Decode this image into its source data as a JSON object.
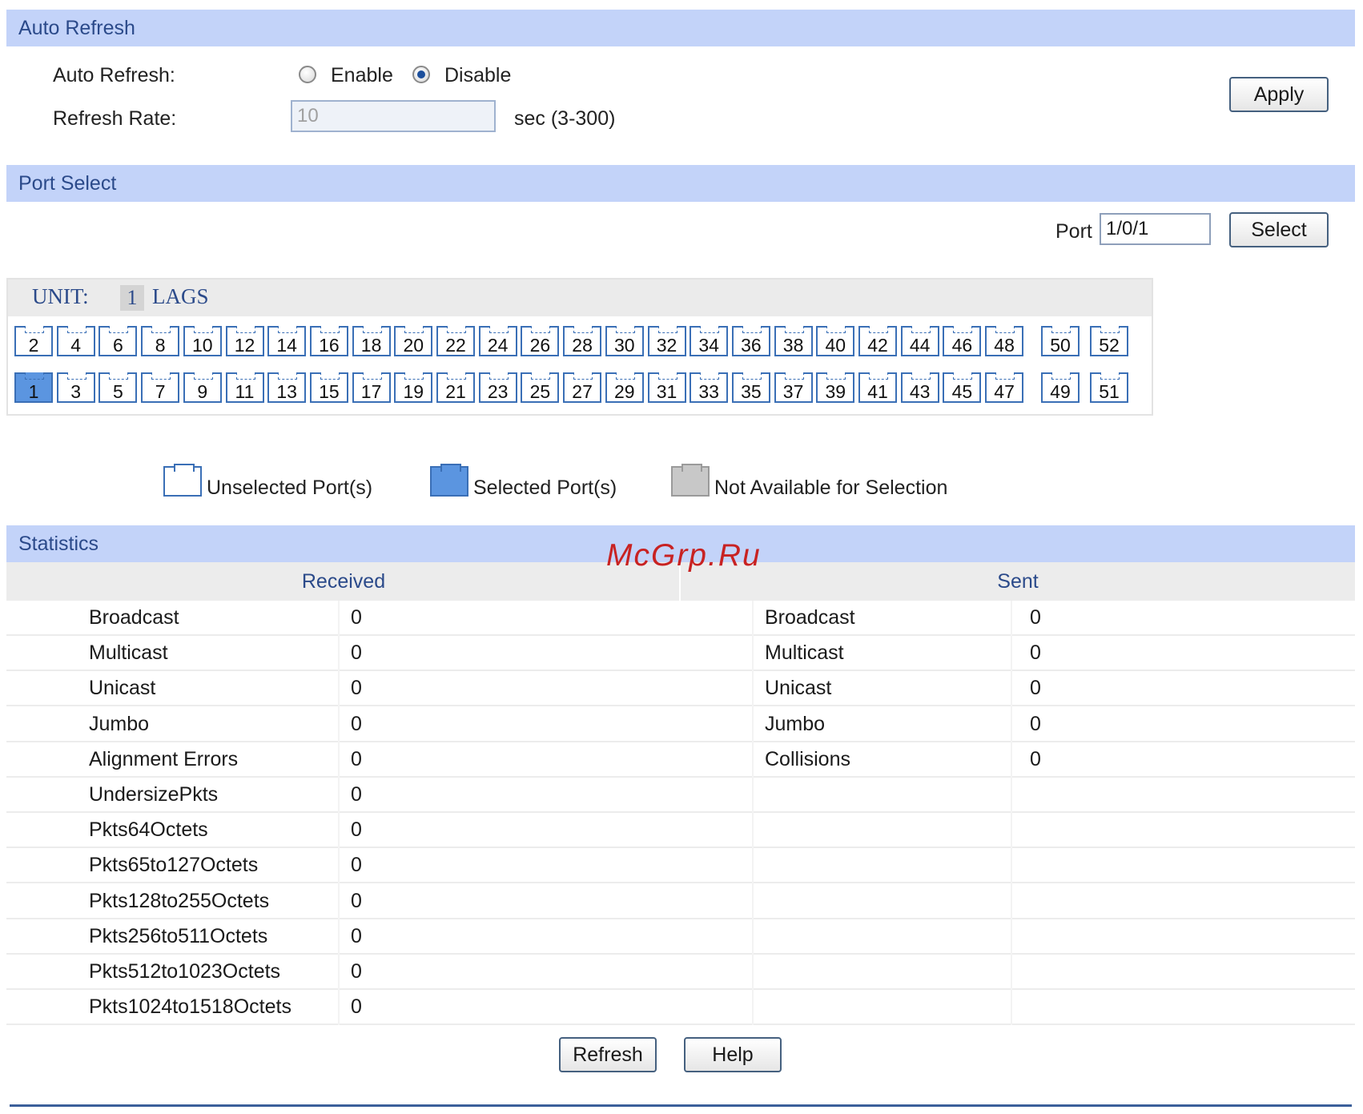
{
  "auto_refresh": {
    "header": "Auto Refresh",
    "label": "Auto Refresh:",
    "enable_label": "Enable",
    "disable_label": "Disable",
    "selected": "Disable",
    "rate_label": "Refresh Rate:",
    "rate_value": "10",
    "rate_unit": "sec (3-300)",
    "apply_label": "Apply"
  },
  "port_select": {
    "header": "Port Select",
    "port_label": "Port",
    "port_value": "1/0/1",
    "select_label": "Select",
    "unit_label": "UNIT:",
    "unit_number": "1",
    "lags_label": "LAGS",
    "top_row": [
      "2",
      "4",
      "6",
      "8",
      "10",
      "12",
      "14",
      "16",
      "18",
      "20",
      "22",
      "24",
      "26",
      "28",
      "30",
      "32",
      "34",
      "36",
      "38",
      "40",
      "42",
      "44",
      "46",
      "48",
      "50",
      "52"
    ],
    "bottom_row": [
      "1",
      "3",
      "5",
      "7",
      "9",
      "11",
      "13",
      "15",
      "17",
      "19",
      "21",
      "23",
      "25",
      "27",
      "29",
      "31",
      "33",
      "35",
      "37",
      "39",
      "41",
      "43",
      "45",
      "47",
      "49",
      "51"
    ],
    "selected_port": "1",
    "legend": {
      "unselected": "Unselected Port(s)",
      "selected": "Selected Port(s)",
      "not_available": "Not Available for Selection"
    },
    "colors": {
      "port_border": "#3a6fb6",
      "selected_fill": "#5b95e0",
      "unavailable_fill": "#c8c8c8"
    }
  },
  "statistics": {
    "header": "Statistics",
    "received_title": "Received",
    "sent_title": "Sent",
    "received": [
      {
        "name": "Broadcast",
        "value": "0"
      },
      {
        "name": "Multicast",
        "value": "0"
      },
      {
        "name": "Unicast",
        "value": "0"
      },
      {
        "name": "Jumbo",
        "value": "0"
      },
      {
        "name": "Alignment Errors",
        "value": "0"
      },
      {
        "name": "UndersizePkts",
        "value": "0"
      },
      {
        "name": "Pkts64Octets",
        "value": "0"
      },
      {
        "name": "Pkts65to127Octets",
        "value": "0"
      },
      {
        "name": "Pkts128to255Octets",
        "value": "0"
      },
      {
        "name": "Pkts256to511Octets",
        "value": "0"
      },
      {
        "name": "Pkts512to1023Octets",
        "value": "0"
      },
      {
        "name": "Pkts1024to1518Octets",
        "value": "0"
      }
    ],
    "sent": [
      {
        "name": "Broadcast",
        "value": "0"
      },
      {
        "name": "Multicast",
        "value": "0"
      },
      {
        "name": "Unicast",
        "value": "0"
      },
      {
        "name": "Jumbo",
        "value": "0"
      },
      {
        "name": "Collisions",
        "value": "0"
      }
    ]
  },
  "footer": {
    "refresh_label": "Refresh",
    "help_label": "Help"
  },
  "watermark": "McGrp.Ru",
  "colors": {
    "section_header_bg": "#c3d3f9",
    "section_header_text": "#2b4a8a"
  }
}
